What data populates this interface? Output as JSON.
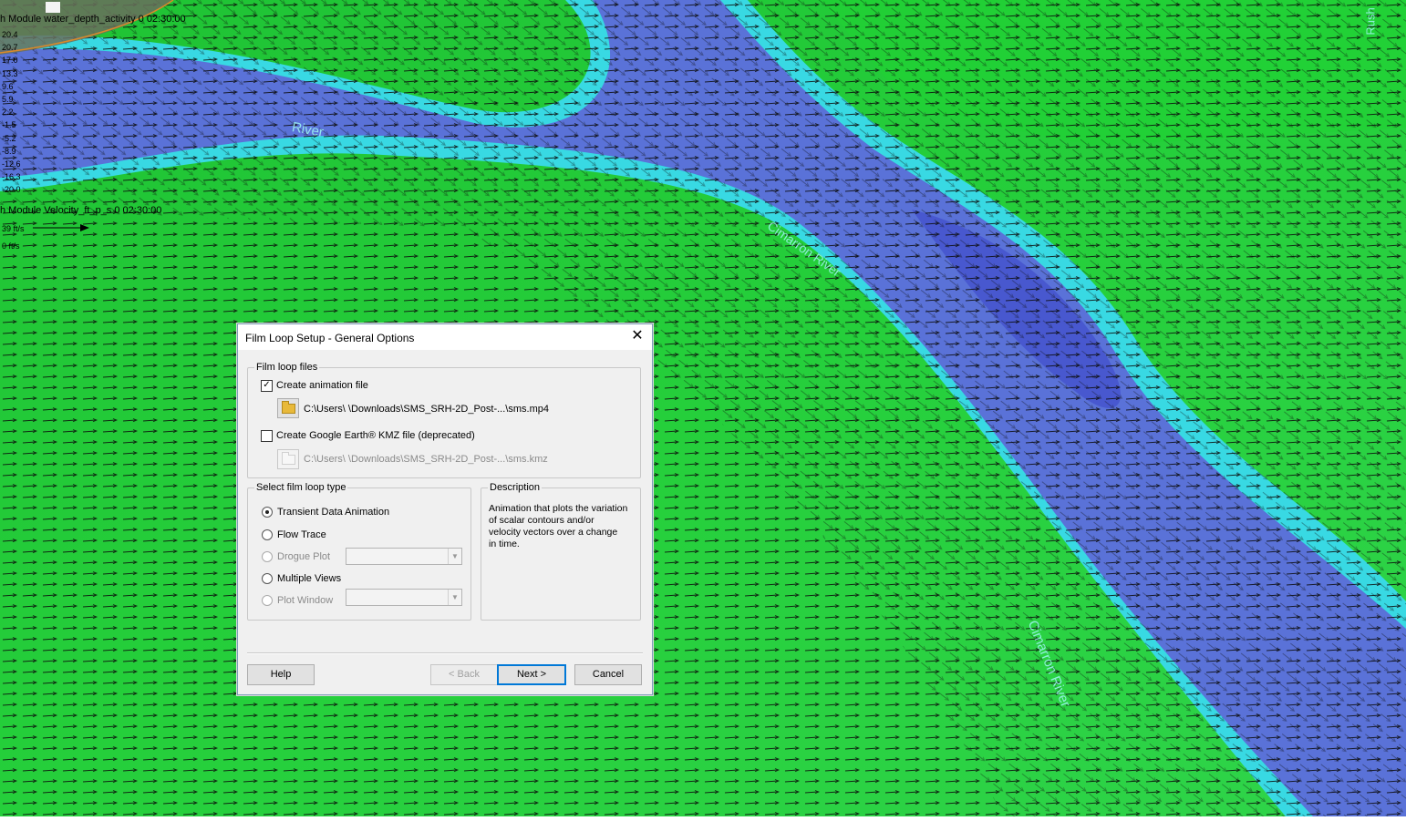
{
  "map": {
    "scalar_legend_title": "h Module water_depth_activity 0 02:30:00",
    "scalar_legend_values": [
      "20.4",
      "20.7",
      "17.0",
      "13.3",
      "9.6",
      "5.9",
      "2.2",
      "-1.5",
      "-5.2",
      "-8.9",
      "-12.6",
      "-16.3",
      "-20.0"
    ],
    "vector_legend_title": "h Module Velocity_ft_p_s 0 02:30:00",
    "vector_legend_max": "39 ft/s",
    "vector_legend_min": "0 ft/s",
    "river_labels": [
      "Cimarron River",
      "River",
      "Cimarron River"
    ],
    "corner_label": "Rush"
  },
  "dialog": {
    "title": "Film Loop Setup - General Options",
    "close_glyph": "✕",
    "film_loop_files": {
      "group_label": "Film loop files",
      "create_animation": {
        "label": "Create animation file",
        "checked": true,
        "path": "C:\\Users\\            \\Downloads\\SMS_SRH-2D_Post-...\\sms.mp4"
      },
      "create_kmz": {
        "label": "Create Google Earth® KMZ file (deprecated)",
        "checked": false,
        "path": "C:\\Users\\            \\Downloads\\SMS_SRH-2D_Post-...\\sms.kmz"
      }
    },
    "loop_type": {
      "group_label": "Select film loop type",
      "options": [
        {
          "label": "Transient Data Animation",
          "selected": true,
          "enabled": true
        },
        {
          "label": "Flow Trace",
          "selected": false,
          "enabled": true
        },
        {
          "label": "Drogue Plot",
          "selected": false,
          "enabled": false
        },
        {
          "label": "Multiple Views",
          "selected": false,
          "enabled": true
        },
        {
          "label": "Plot Window",
          "selected": false,
          "enabled": false
        }
      ]
    },
    "description": {
      "group_label": "Description",
      "text_lines": [
        "Animation that plots the variation",
        "of scalar contours and/or",
        "velocity vectors over a change",
        "in time."
      ]
    },
    "buttons": {
      "help": "Help",
      "back": "< Back",
      "next": "Next >",
      "cancel": "Cancel"
    }
  },
  "colors": {
    "water_dark": "#4a5fd0",
    "water_light": "#3fd8e6",
    "land_green": "#22c93a",
    "dialog_bg": "#f0f0f0",
    "accent": "#0078d7"
  }
}
